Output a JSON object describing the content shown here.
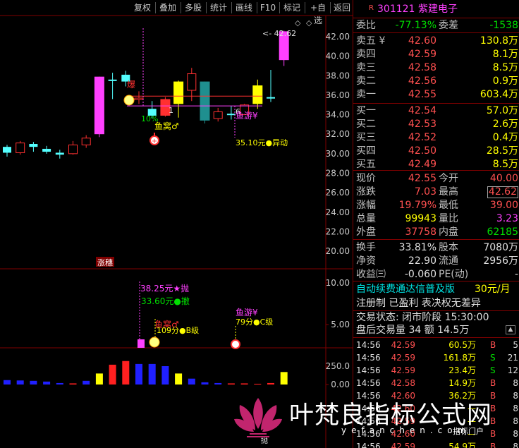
{
  "toolbar": {
    "buttons": [
      "复权",
      "叠加",
      "多股",
      "统计",
      "画线",
      "F10",
      "标记",
      "+自选",
      "返回"
    ]
  },
  "stock": {
    "badge": "R",
    "code": "301121",
    "name": "紫建电子"
  },
  "order_book": {
    "weibi_label": "委比",
    "weibi": "-77.13%",
    "weicha_label": "委差",
    "weicha": "-1538",
    "asks": [
      {
        "label": "卖五",
        "flag": "¥",
        "price": "42.60",
        "vol": "130.8万"
      },
      {
        "label": "卖四",
        "flag": "",
        "price": "42.59",
        "vol": "8.1万"
      },
      {
        "label": "卖三",
        "flag": "",
        "price": "42.58",
        "vol": "8.5万"
      },
      {
        "label": "卖二",
        "flag": "",
        "price": "42.56",
        "vol": "0.9万"
      },
      {
        "label": "卖一",
        "flag": "",
        "price": "42.55",
        "vol": "603.4万"
      }
    ],
    "bids": [
      {
        "label": "买一",
        "price": "42.54",
        "vol": "57.0万"
      },
      {
        "label": "买二",
        "price": "42.53",
        "vol": "2.6万"
      },
      {
        "label": "买三",
        "price": "42.52",
        "vol": "0.4万"
      },
      {
        "label": "买四",
        "price": "42.50",
        "vol": "28.5万"
      },
      {
        "label": "买五",
        "price": "42.49",
        "vol": "8.5万"
      }
    ]
  },
  "quote": {
    "rows": [
      {
        "l1": "现价",
        "v1": "42.55",
        "l2": "今开",
        "v2": "40.00"
      },
      {
        "l1": "涨跌",
        "v1": "7.03",
        "l2": "最高",
        "v2": "42.62"
      },
      {
        "l1": "涨幅",
        "v1": "19.79%",
        "l2": "最低",
        "v2": "39.00"
      },
      {
        "l1": "总量",
        "v1": "99943",
        "l2": "量比",
        "v2": "3.23"
      },
      {
        "l1": "外盘",
        "v1": "37758",
        "l2": "内盘",
        "v2": "62185"
      }
    ],
    "rows2": [
      {
        "l1": "换手",
        "v1": "33.81%",
        "l2": "股本",
        "v2": "7080万"
      },
      {
        "l1": "净资",
        "v1": "22.90",
        "l2": "流通",
        "v2": "2956万"
      },
      {
        "l1": "收益㈢",
        "v1": "-0.060",
        "l2": "PE(动)",
        "v2": "-"
      }
    ]
  },
  "info": {
    "line1": "自动续费通达信普及版",
    "line1b": "30元/月",
    "line2": "注册制 已盈利 表决权无差异",
    "line3": "交易状态: 闭市阶段 15:30:00",
    "line4": "盘后交易量 34 额 14.5万"
  },
  "ticks": [
    {
      "time": "14:56",
      "price": "42.59",
      "vol": "60.5万",
      "side": "B",
      "n": "5"
    },
    {
      "time": "14:56",
      "price": "42.59",
      "vol": "161.8万",
      "side": "S",
      "n": "21"
    },
    {
      "time": "14:56",
      "price": "42.59",
      "vol": "23.4万",
      "side": "S",
      "n": "12"
    },
    {
      "time": "14:56",
      "price": "42.58",
      "vol": "14.9万",
      "side": "B",
      "n": "8"
    },
    {
      "time": "14:56",
      "price": "42.60",
      "vol": "36.2万",
      "side": "B",
      "n": "8"
    },
    {
      "time": "14:56",
      "price": "42.60",
      "vol": "—",
      "side": "B",
      "n": "8"
    },
    {
      "time": "14:56",
      "price": "42.59",
      "vol": "—",
      "side": "B",
      "n": "8"
    },
    {
      "time": "14:56",
      "price": "42.60",
      "vol": "—",
      "side": "B",
      "n": "8"
    },
    {
      "time": "14:56",
      "price": "42.59",
      "vol": "54.9万",
      "side": "B",
      "n": "8"
    }
  ],
  "chart_data": {
    "type": "candlestick",
    "price_axis": [
      "42.00",
      "40.00",
      "38.00",
      "36.00",
      "34.00",
      "32.00",
      "30.00",
      "28.00",
      "26.00",
      "24.00",
      "22.00",
      "20.00"
    ],
    "ind_axis": [
      "10.00",
      "5.00"
    ],
    "vol_axis": [
      "250.0",
      "0.00"
    ],
    "high_label": "42.62",
    "limit_tag": "涨穗",
    "candles": [
      {
        "o": 30.1,
        "c": 30.7,
        "h": 30.9,
        "l": 29.7,
        "color": "cyan"
      },
      {
        "o": 31.1,
        "c": 30.1,
        "h": 31.3,
        "l": 29.9,
        "color": "hollow"
      },
      {
        "o": 30.7,
        "c": 31.0,
        "h": 31.2,
        "l": 30.2,
        "color": "cyan"
      },
      {
        "o": 30.5,
        "c": 30.2,
        "h": 30.8,
        "l": 30.0,
        "color": "cyan"
      },
      {
        "o": 30.1,
        "c": 29.9,
        "h": 30.4,
        "l": 29.5,
        "color": "cyan"
      },
      {
        "o": 30.0,
        "c": 30.9,
        "h": 31.3,
        "l": 29.9,
        "color": "hollow"
      },
      {
        "o": 30.9,
        "c": 31.6,
        "h": 31.9,
        "l": 30.6,
        "color": "hollow"
      },
      {
        "o": 32.0,
        "c": 37.9,
        "h": 37.9,
        "l": 31.7,
        "color": "magenta"
      },
      {
        "o": 37.6,
        "c": 37.6,
        "h": 38.3,
        "l": 35.6,
        "color": "cyan"
      },
      {
        "o": 37.4,
        "c": 38.1,
        "h": 38.5,
        "l": 36.9,
        "color": "cyan"
      },
      {
        "o": 35.6,
        "c": 35.7,
        "h": 36.4,
        "l": 35.1,
        "color": "hollow"
      },
      {
        "o": 34.6,
        "c": 33.9,
        "h": 35.4,
        "l": 33.6,
        "color": "cyan"
      },
      {
        "o": 35.6,
        "c": 33.9,
        "h": 35.8,
        "l": 33.8,
        "color": "red"
      },
      {
        "o": 35.1,
        "c": 37.4,
        "h": 37.5,
        "l": 33.7,
        "color": "yellow"
      },
      {
        "o": 38.2,
        "c": 36.5,
        "h": 38.8,
        "l": 35.4,
        "color": "hollow"
      },
      {
        "o": 37.4,
        "c": 33.4,
        "h": 37.4,
        "l": 33.1,
        "color": "teal"
      },
      {
        "o": 34.3,
        "c": 33.6,
        "h": 34.7,
        "l": 33.3,
        "color": "hollow"
      },
      {
        "o": 34.1,
        "c": 34.1,
        "h": 34.9,
        "l": 33.5,
        "color": "cyan"
      },
      {
        "o": 34.0,
        "c": 35.0,
        "h": 35.1,
        "l": 34.0,
        "color": "hollow"
      },
      {
        "o": 35.1,
        "c": 37.0,
        "h": 37.6,
        "l": 34.6,
        "color": "yellow"
      },
      {
        "o": 35.8,
        "c": 35.8,
        "h": 38.6,
        "l": 35.3,
        "color": "cyan"
      },
      {
        "o": 39.6,
        "c": 42.55,
        "h": 42.62,
        "l": 39.0,
        "color": "magenta"
      }
    ],
    "volumes": [
      {
        "v": 60,
        "c": "blue"
      },
      {
        "v": 55,
        "c": "blue"
      },
      {
        "v": 50,
        "c": "blue"
      },
      {
        "v": 40,
        "c": "blue"
      },
      {
        "v": 20,
        "c": "blue"
      },
      {
        "v": 15,
        "c": "red"
      },
      {
        "v": 50,
        "c": "blue"
      },
      {
        "v": 150,
        "c": "yellow"
      },
      {
        "v": 270,
        "c": "red"
      },
      {
        "v": 320,
        "c": "red"
      },
      {
        "v": 280,
        "c": "blue"
      },
      {
        "v": 280,
        "c": "blue"
      },
      {
        "v": 250,
        "c": "blue"
      },
      {
        "v": 150,
        "c": "yellow"
      },
      {
        "v": 80,
        "c": "blue"
      },
      {
        "v": 30,
        "c": "blue"
      },
      {
        "v": 20,
        "c": "blue"
      },
      {
        "v": 15,
        "c": "red"
      },
      {
        "v": 15,
        "c": "red"
      },
      {
        "v": 10,
        "c": "red"
      },
      {
        "v": 20,
        "c": "red"
      },
      {
        "v": 170,
        "c": "yellow"
      }
    ],
    "annotations": {
      "bao": "爆",
      "yuwo1": "鱼窝♂",
      "pct10": "10%",
      "one": "1",
      "six": "6",
      "yuyou1": "鱼游¥",
      "yidong": "35.10元●异动",
      "pao": "38.25元★抛",
      "che": "33.60元●撤",
      "yuwo2": "鱼窝♂",
      "fen109": "109分●B级",
      "yuyou2": "鱼游¥",
      "fen79": "79分●C级",
      "bottom_tag": "抛"
    }
  },
  "watermark": {
    "title": "叶梵良指标公式网",
    "url": "yefanchen.com",
    "tag": "指标门户"
  },
  "colors": {
    "up": "#ff3030",
    "down": "#54ffff",
    "yellow": "#ffff00",
    "magenta": "#ff40ff",
    "teal": "#1f8f8f",
    "grid": "#800000"
  }
}
